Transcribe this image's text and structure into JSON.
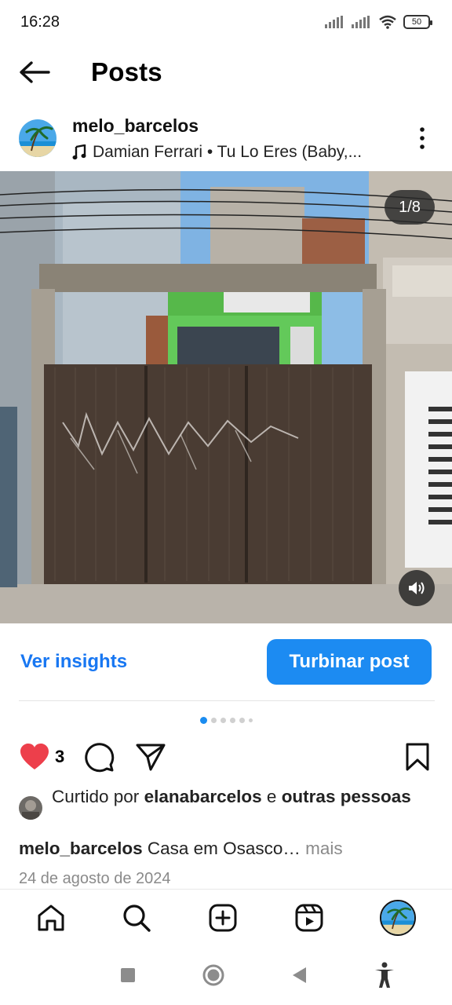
{
  "status_bar": {
    "time": "16:28",
    "battery": "50",
    "icons": [
      "signal-icon",
      "signal-icon",
      "wifi-icon",
      "battery-icon"
    ]
  },
  "header": {
    "title": "Posts",
    "back_icon": "arrow-left-icon"
  },
  "post": {
    "username": "melo_barcelos",
    "music": "Damian Ferrari • Tu Lo Eres (Baby,...",
    "music_icon": "music-note-icon",
    "more_icon": "more-vertical-icon",
    "image_counter": "1/8",
    "sound_icon": "speaker-icon"
  },
  "actions": {
    "insights_label": "Ver insights",
    "boost_label": "Turbinar post",
    "like_count": "3",
    "carousel_total": 6,
    "carousel_active": 1
  },
  "likes": {
    "prefix": "Curtido por ",
    "user": "elanabarcelos",
    "middle": " e ",
    "suffix": "outras pessoas"
  },
  "caption": {
    "username": "melo_barcelos",
    "text": " Casa em Osasco… ",
    "more": "mais"
  },
  "date": "24 de agosto de 2024",
  "bottom_nav": [
    "home-icon",
    "search-icon",
    "add-post-icon",
    "reels-icon",
    "profile-avatar"
  ],
  "system_nav": [
    "recent-apps-icon",
    "home-circle-icon",
    "back-triangle-icon",
    "accessibility-icon"
  ],
  "colors": {
    "accent": "#1877f2",
    "boost_button": "#1c8bf2",
    "like_red": "#ed3f4b"
  }
}
